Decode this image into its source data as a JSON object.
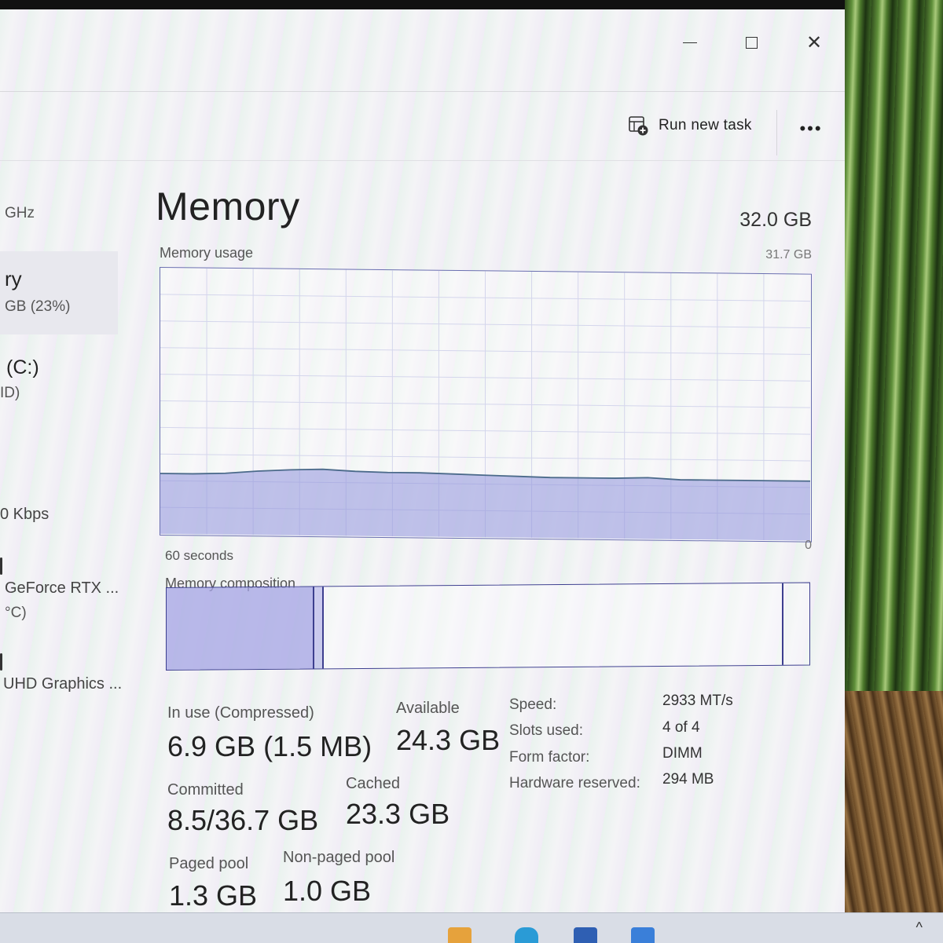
{
  "window": {
    "minimize_glyph": "—",
    "close_glyph": "✕"
  },
  "command_bar": {
    "run_new_task": "Run new task",
    "more": "•••",
    "run_icon": "run-task-icon",
    "more_icon": "more-options-icon"
  },
  "nav": {
    "items": [
      {
        "line1": "",
        "line2": "GHz"
      },
      {
        "line1": "ry",
        "line2": "GB (23%)"
      },
      {
        "line1": "(C:)",
        "line2": "ID)"
      },
      {
        "line1": "",
        "line2": "0 Kbps"
      },
      {
        "line1": "GeForce RTX ...",
        "line2": "°C)"
      },
      {
        "line1": "UHD Graphics ...",
        "line2": ""
      }
    ]
  },
  "memory": {
    "title": "Memory",
    "total": "32.0 GB",
    "usage_label": "Memory usage",
    "usage_max": "31.7 GB",
    "axis_left": "60 seconds",
    "axis_right": "0",
    "composition_label": "Memory composition",
    "composition": {
      "in_use_fraction": 0.23,
      "modified_fraction": 0.015,
      "standby_fraction": 0.715,
      "free_fraction": 0.04
    }
  },
  "stats": {
    "in_use_label": "In use (Compressed)",
    "in_use_value": "6.9 GB (1.5 MB)",
    "available_label": "Available",
    "available_value": "24.3 GB",
    "committed_label": "Committed",
    "committed_value": "8.5/36.7 GB",
    "cached_label": "Cached",
    "cached_value": "23.3 GB",
    "paged_label": "Paged pool",
    "paged_value": "1.3 GB",
    "nonpaged_label": "Non-paged pool",
    "nonpaged_value": "1.0 GB"
  },
  "details": {
    "speed_label": "Speed:",
    "speed_value": "2933 MT/s",
    "slots_label": "Slots used:",
    "slots_value": "4 of 4",
    "form_label": "Form factor:",
    "form_value": "DIMM",
    "reserved_label": "Hardware reserved:",
    "reserved_value": "294 MB"
  },
  "taskbar": {
    "tray_chevron": "^"
  },
  "chart_data": {
    "type": "area",
    "title": "Memory usage",
    "xlabel": "60 seconds",
    "ylabel": "",
    "ylim": [
      0,
      31.7
    ],
    "x": [
      60,
      57,
      54,
      51,
      48,
      45,
      42,
      39,
      36,
      33,
      30,
      27,
      24,
      21,
      18,
      15,
      12,
      9,
      6,
      3,
      0
    ],
    "series": [
      {
        "values": [
          7.2,
          7.2,
          7.3,
          7.6,
          7.8,
          7.9,
          7.7,
          7.6,
          7.6,
          7.5,
          7.4,
          7.3,
          7.2,
          7.2,
          7.2,
          7.3,
          7.1,
          7.1,
          7.1,
          7.1,
          7.1
        ]
      }
    ],
    "grid": true,
    "color": "#8f94dd"
  }
}
